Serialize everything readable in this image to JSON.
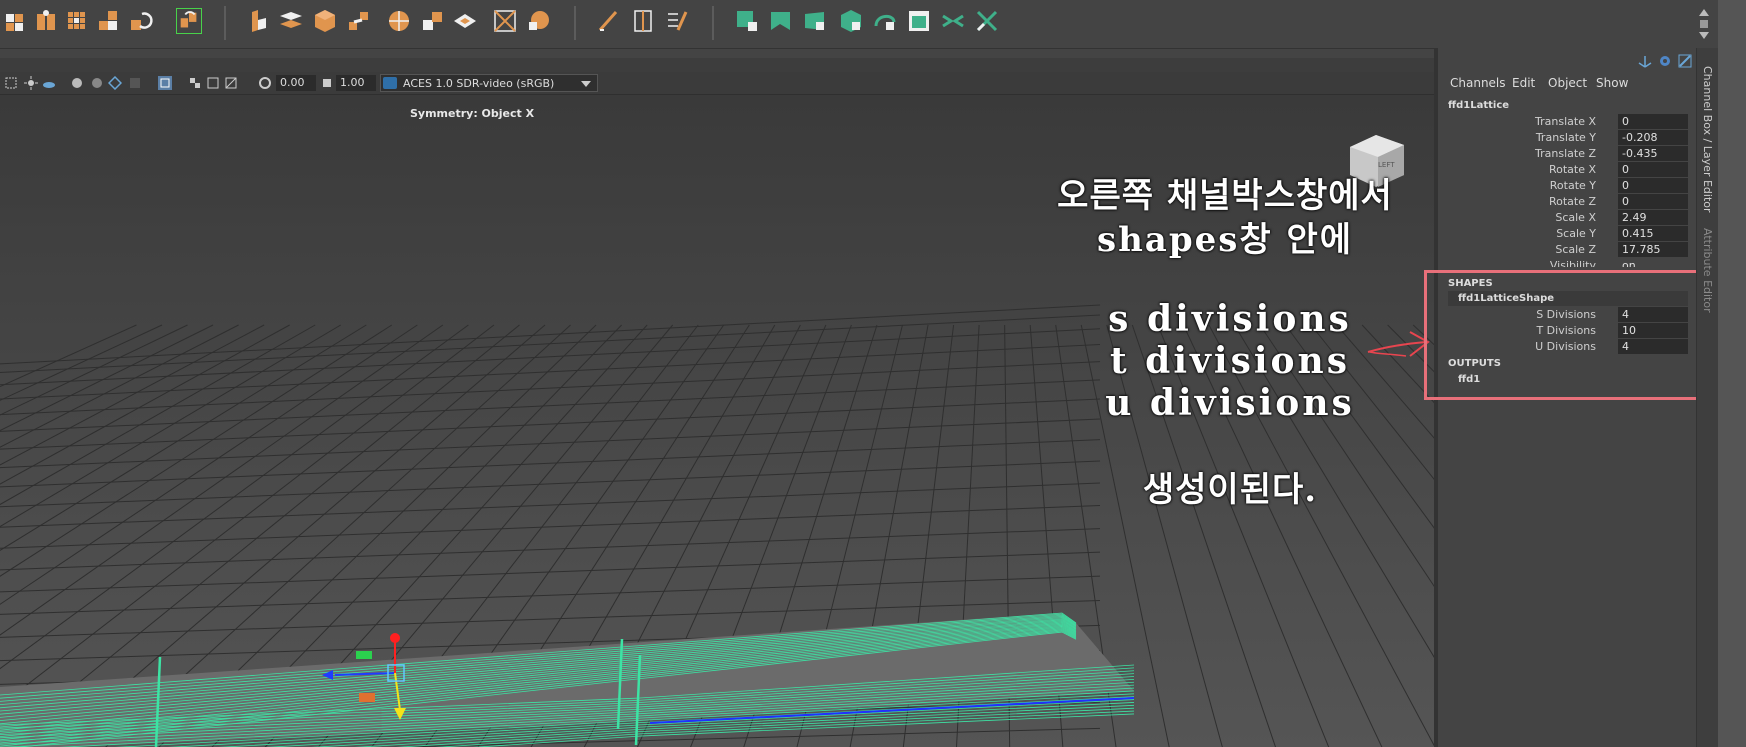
{
  "viewport": {
    "exposure": "0.00",
    "gamma": "1.00",
    "color_space": "ACES 1.0 SDR-video (sRGB)",
    "symmetry": "Symmetry: Object X"
  },
  "annotation": {
    "line1": "오른쪽 채널박스창에서",
    "line2": "shapes창 안에",
    "line3": "s divisions",
    "line4": "t divisions",
    "line5": "u divisions",
    "line6": "생성이된다."
  },
  "channel_box": {
    "menus": [
      "Channels",
      "Edit",
      "Object",
      "Show"
    ],
    "node": "ffd1Lattice",
    "attributes": [
      {
        "label": "Translate X",
        "value": "0"
      },
      {
        "label": "Translate Y",
        "value": "-0.208"
      },
      {
        "label": "Translate Z",
        "value": "-0.435"
      },
      {
        "label": "Rotate X",
        "value": "0"
      },
      {
        "label": "Rotate Y",
        "value": "0"
      },
      {
        "label": "Rotate Z",
        "value": "0"
      },
      {
        "label": "Scale X",
        "value": "2.49"
      },
      {
        "label": "Scale Y",
        "value": "0.415"
      },
      {
        "label": "Scale Z",
        "value": "17.785"
      },
      {
        "label": "Visibility",
        "value": "on"
      }
    ],
    "shapes_header": "SHAPES",
    "shape_node": "ffd1LatticeShape",
    "shape_attributes": [
      {
        "label": "S Divisions",
        "value": "4"
      },
      {
        "label": "T Divisions",
        "value": "10"
      },
      {
        "label": "U Divisions",
        "value": "4"
      }
    ],
    "outputs_header": "OUTPUTS",
    "output_node": "ffd1"
  },
  "side_tabs": {
    "tab1": "Channel Box / Layer Editor",
    "tab2": "Attribute Editor"
  },
  "icons": {
    "shelf": [
      "lattice-icon",
      "deformer-icon",
      "grid-icon",
      "boolean-icon",
      "refresh-icon",
      "duplicate-icon",
      "extrude-icon",
      "bevel-icon",
      "cube-icon",
      "bridge-icon",
      "sphere-icon",
      "combine-icon",
      "plane-icon",
      "separate-icon",
      "smooth-icon",
      "pencil-icon",
      "split-icon",
      "multicut-icon",
      "uv-icon",
      "cut-icon",
      "unfold-icon",
      "layout-icon",
      "transfer-icon",
      "checker-icon",
      "symmetry-icon",
      "close-icon"
    ]
  },
  "colors": {
    "lattice": "#3de3a4",
    "highlight": "#e8707a"
  }
}
